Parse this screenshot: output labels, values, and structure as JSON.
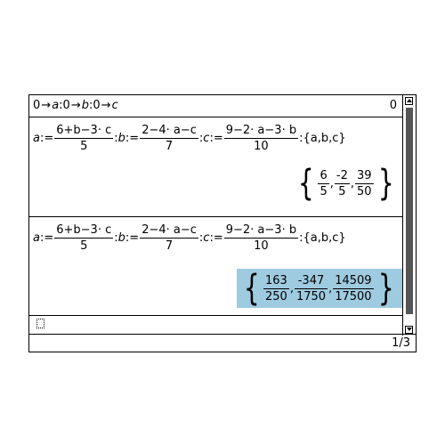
{
  "entries": {
    "e1": {
      "input": {
        "v1": "0",
        "arrow": "→",
        "a": "a",
        "colon": ":",
        "v2": "0",
        "b": "b",
        "v3": "0",
        "c": "c"
      },
      "result": "0"
    },
    "e2": {
      "a_def": {
        "name": "a",
        "assign": ":=",
        "num": "6+b−3· c",
        "den": "5"
      },
      "b_def": {
        "name": "b",
        "assign": ":=",
        "num": "2−4· a−c",
        "den": "7"
      },
      "c_def": {
        "name": "c",
        "assign": ":=",
        "num": "9−2· a−3· b",
        "den": "10"
      },
      "list": "{a,b,c}",
      "result": {
        "f1_num": "6",
        "f1_den": "5",
        "f2_num": "-2",
        "f2_den": "5",
        "f3_num": "39",
        "f3_den": "50"
      }
    },
    "e3": {
      "a_def": {
        "name": "a",
        "assign": ":=",
        "num": "6+b−3· c",
        "den": "5"
      },
      "b_def": {
        "name": "b",
        "assign": ":=",
        "num": "2−4· a−c",
        "den": "7"
      },
      "c_def": {
        "name": "c",
        "assign": ":=",
        "num": "9−2· a−3· b",
        "den": "10"
      },
      "list": "{a,b,c}",
      "result": {
        "f1_num": "163",
        "f1_den": "250",
        "f2_num": "-347",
        "f2_den": "1750",
        "f3_num": "14509",
        "f3_den": "17500"
      }
    }
  },
  "status": {
    "page": "1/3"
  },
  "colors": {
    "highlight": "#9fcbe0",
    "scrollbar_thumb": "#555555"
  }
}
